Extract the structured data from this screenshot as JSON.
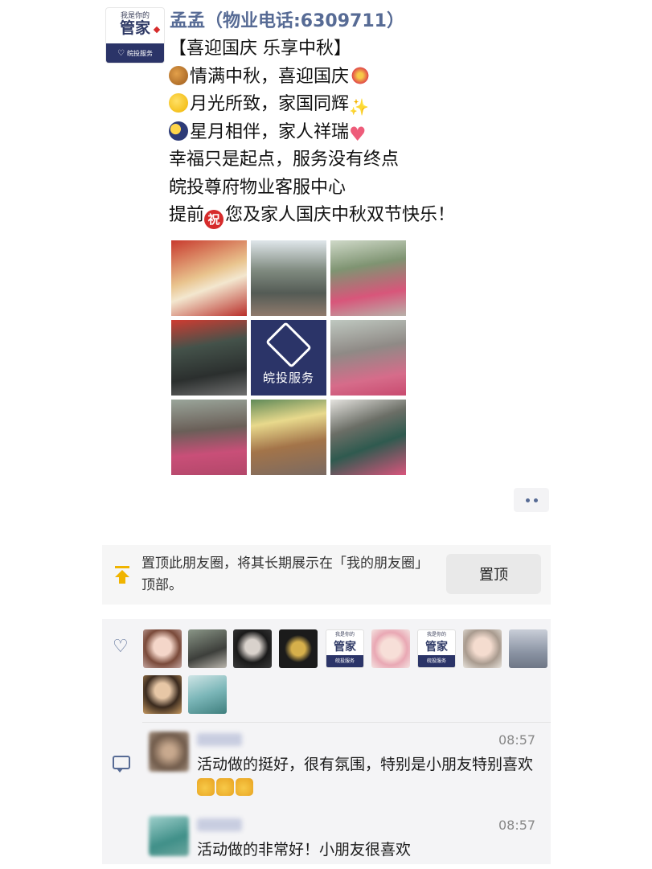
{
  "post": {
    "avatar": {
      "small_text": "我是你的",
      "big_text": "管家",
      "bar_text": "皖投服务"
    },
    "poster_name": "孟孟（物业电话:6309711）",
    "lines": {
      "l1": "【喜迎国庆   乐享中秋】",
      "l2": "情满中秋，喜迎国庆",
      "l3": "月光所致，家国同辉",
      "l4": "星月相伴，家人祥瑞",
      "l5": "幸福只是起点，服务没有终点",
      "l6": "皖投尊府物业客服中心",
      "l7a": "提前",
      "l7_badge": "祝",
      "l7b": "您及家人国庆中秋双节快乐！"
    },
    "grid_center_text": "皖投服务"
  },
  "pin": {
    "text": "置顶此朋友圈，将其长期展示在「我的朋友圈」顶部。",
    "button": "置顶"
  },
  "likes": {
    "brand_small": "我是你的",
    "brand_big": "管家",
    "brand_bar": "皖投服务"
  },
  "comments": [
    {
      "time": "08:57",
      "text": "活动做的挺好，很有氛围，特别是小朋友特别喜欢"
    },
    {
      "time": "08:57",
      "text": "活动做的非常好！小朋友很喜欢"
    }
  ],
  "colors": {
    "link_blue": "#576b95",
    "brand_navy": "#2b3468",
    "pin_yellow": "#f0b400"
  }
}
